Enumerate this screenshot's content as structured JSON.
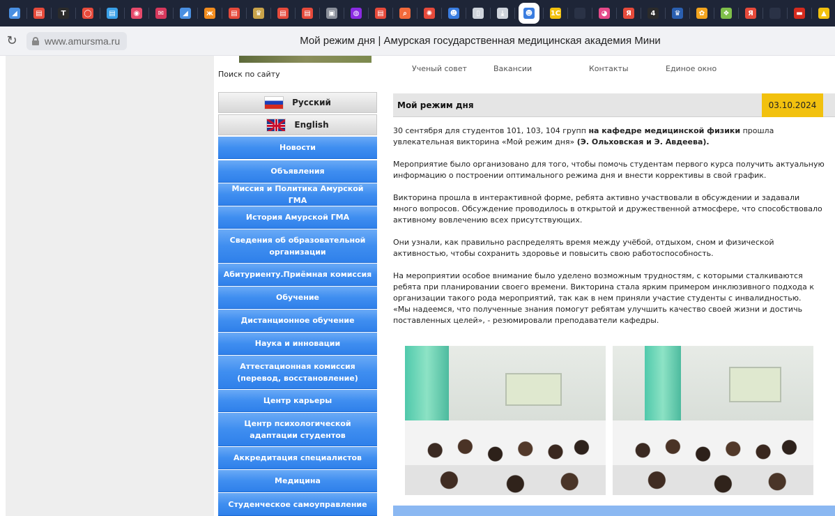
{
  "browser": {
    "url": "www.amursma.ru",
    "page_title": "Мой режим дня | Амурская государственная медицинская академия Мини",
    "tab_icons": [
      {
        "name": "zen-icon",
        "color": "#4a90e2",
        "glyph": "◢"
      },
      {
        "name": "pdf-icon",
        "color": "#e64a3b",
        "glyph": "▤"
      },
      {
        "name": "t-icon",
        "color": "#2b2b2b",
        "glyph": "T"
      },
      {
        "name": "circle-icon",
        "color": "#e64a3b",
        "glyph": "◯"
      },
      {
        "name": "blue-doc-icon",
        "color": "#3aa0e8",
        "glyph": "▤"
      },
      {
        "name": "target-icon",
        "color": "#e64a6b",
        "glyph": "◉"
      },
      {
        "name": "mail-icon",
        "color": "#d6385c",
        "glyph": "✉"
      },
      {
        "name": "zen-icon",
        "color": "#4a90e2",
        "glyph": "◢"
      },
      {
        "name": "ok-icon",
        "color": "#f28c1e",
        "glyph": "ж"
      },
      {
        "name": "pdf-icon",
        "color": "#e64a3b",
        "glyph": "▤"
      },
      {
        "name": "emblem-icon",
        "color": "#c9a34a",
        "glyph": "♛"
      },
      {
        "name": "pdf-icon",
        "color": "#e64a3b",
        "glyph": "▤"
      },
      {
        "name": "pdf-icon",
        "color": "#e64a3b",
        "glyph": "▤"
      },
      {
        "name": "image-icon",
        "color": "#8a8f9a",
        "glyph": "▣"
      },
      {
        "name": "purple-icon",
        "color": "#8a2be2",
        "glyph": "◍"
      },
      {
        "name": "pdf-icon",
        "color": "#e64a3b",
        "glyph": "▤"
      },
      {
        "name": "search-icon",
        "color": "#f26a3b",
        "glyph": "⌕"
      },
      {
        "name": "gear-red-icon",
        "color": "#e64a3b",
        "glyph": "✺"
      },
      {
        "name": "avatar-icon",
        "color": "#3a7de0",
        "glyph": "☻"
      },
      {
        "name": "file-icon",
        "color": "#cfd4dc",
        "glyph": "▯"
      },
      {
        "name": "download-icon",
        "color": "#cfd4dc",
        "glyph": "⤓"
      },
      {
        "name": "active-tab-icon",
        "color": "#3a7de0",
        "glyph": "☻"
      },
      {
        "name": "1c-icon",
        "color": "#f2c10e",
        "glyph": "1С"
      },
      {
        "name": "blank-icon",
        "color": "#2a3246",
        "glyph": ""
      },
      {
        "name": "pink-icon",
        "color": "#e64a8a",
        "glyph": "◕"
      },
      {
        "name": "yandex-icon",
        "color": "#e64a3b",
        "glyph": "Я"
      },
      {
        "name": "four-icon",
        "color": "#2b2b2b",
        "glyph": "4"
      },
      {
        "name": "emblem-blue-icon",
        "color": "#2a5fb0",
        "glyph": "♛"
      },
      {
        "name": "flower-icon",
        "color": "#f2a41e",
        "glyph": "✿"
      },
      {
        "name": "colorful-icon",
        "color": "#7fbf4a",
        "glyph": "❖"
      },
      {
        "name": "yandex-icon",
        "color": "#e64a3b",
        "glyph": "Я"
      },
      {
        "name": "blank-icon",
        "color": "#2a3246",
        "glyph": ""
      },
      {
        "name": "flag-icon",
        "color": "#d52b1e",
        "glyph": "▬"
      },
      {
        "name": "photo-icon",
        "color": "#f2c10e",
        "glyph": "▲"
      }
    ]
  },
  "sidebar": {
    "search_label": "Поиск по сайту",
    "languages": [
      "Русский",
      "English"
    ],
    "menu": [
      "Новости",
      "Объявления",
      "Миссия и Политика Амурской ГМА",
      "История Амурской ГМА",
      "Сведения об образовательной организации",
      "Абитуриенту.Приёмная комиссия",
      "Обучение",
      "Дистанционное обучение",
      "Наука и инновации",
      "Аттестационная комиссия (перевод, восстановление)",
      "Центр карьеры",
      "Центр психологической адаптации студентов",
      "Аккредитация специалистов",
      "Медицина",
      "Студенческое самоуправление"
    ]
  },
  "topnav": [
    "Ученый совет",
    "Вакансии",
    "Контакты",
    "Единое окно"
  ],
  "article": {
    "title": "Мой режим дня",
    "date": "03.10.2024",
    "p1_a": "30 сентября для студентов 101, 103, 104 групп ",
    "p1_b": "на кафедре медицинской физики",
    "p1_c": " прошла увлекательная викторина «Мой режим дня» ",
    "p1_d": "(Э. Ольховская и Э. Авдеева).",
    "p2": "Мероприятие было организовано для того, чтобы помочь студентам первого курса получить актуальную информацию о построении оптимального режима дня и внести коррективы в свой график.",
    "p3": "Викторина прошла в интерактивной форме, ребята активно участвовали в обсуждении и задавали много вопросов. Обсуждение проводилось в открытой и дружественной атмосфере, что способствовало активному вовлечению всех присутствующих.",
    "p4": "Они узнали, как правильно распределять время между учёбой, отдыхом, сном и физической активностью, чтобы сохранить здоровье и повысить свою работоспособность.",
    "p5a": "На мероприятии особое внимание было уделено возможным трудностям, с которыми сталкиваются ребята при планировании своего времени. Викторина стала ярким примером инклюзивного подхода к организации такого рода мероприятий, так как в нем приняли участие студенты с инвалидностью.",
    "p5b": "«Мы надеемся, что полученные знания помогут ребятам улучшить качество своей жизни и достичь поставленных целей», - резюмировали преподаватели кафедры."
  },
  "colors": {
    "menu_blue": "#3f8ef0",
    "date_yellow": "#f2c10e",
    "title_gray": "#e5e5e5",
    "tabbar_bg": "#1e2537"
  }
}
